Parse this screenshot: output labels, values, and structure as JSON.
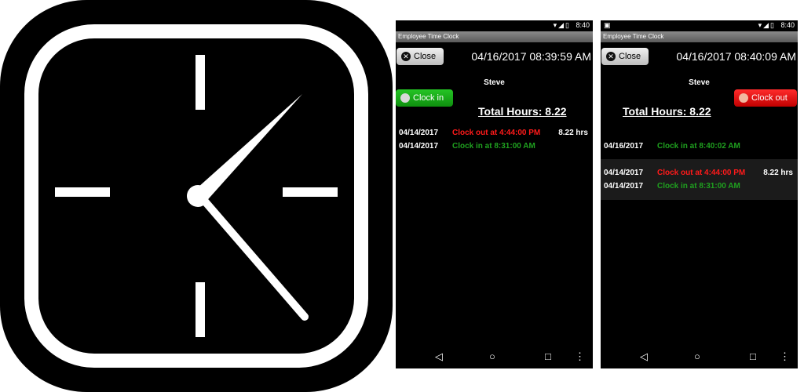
{
  "statusbar": {
    "time": "8:40",
    "signal_icons": "▾◢▯"
  },
  "app": {
    "title": "Employee Time Clock"
  },
  "screens": [
    {
      "close_label": "Close",
      "datetime": "04/16/2017 08:39:59 AM",
      "employee": "Steve",
      "clock_button_label": "Clock in",
      "total_hours": "Total Hours: 8.22",
      "entries": [
        {
          "date": "04/14/2017",
          "event": "Clock out at 4:44:00 PM",
          "hours": "8.22 hrs",
          "type": "out"
        },
        {
          "date": "04/14/2017",
          "event": "Clock in at 8:31:00 AM",
          "hours": "",
          "type": "in"
        }
      ]
    },
    {
      "close_label": "Close",
      "datetime": "04/16/2017 08:40:09 AM",
      "employee": "Steve",
      "clock_button_label": "Clock out",
      "total_hours": "Total Hours: 8.22",
      "entries": [
        {
          "date": "04/16/2017",
          "event": "Clock in at 8:40:02 AM",
          "hours": "",
          "type": "in"
        },
        {
          "date": "04/14/2017",
          "event": "Clock out at 4:44:00 PM",
          "hours": "8.22 hrs",
          "type": "out"
        },
        {
          "date": "04/14/2017",
          "event": "Clock in at 8:31:00 AM",
          "hours": "",
          "type": "in"
        }
      ]
    }
  ],
  "navbar": {
    "back": "◁",
    "home": "○",
    "recents": "□",
    "menu": "⋮"
  },
  "colors": {
    "clock_in": "#1fa11f",
    "clock_out": "#ff1a1a",
    "background": "#000000"
  }
}
